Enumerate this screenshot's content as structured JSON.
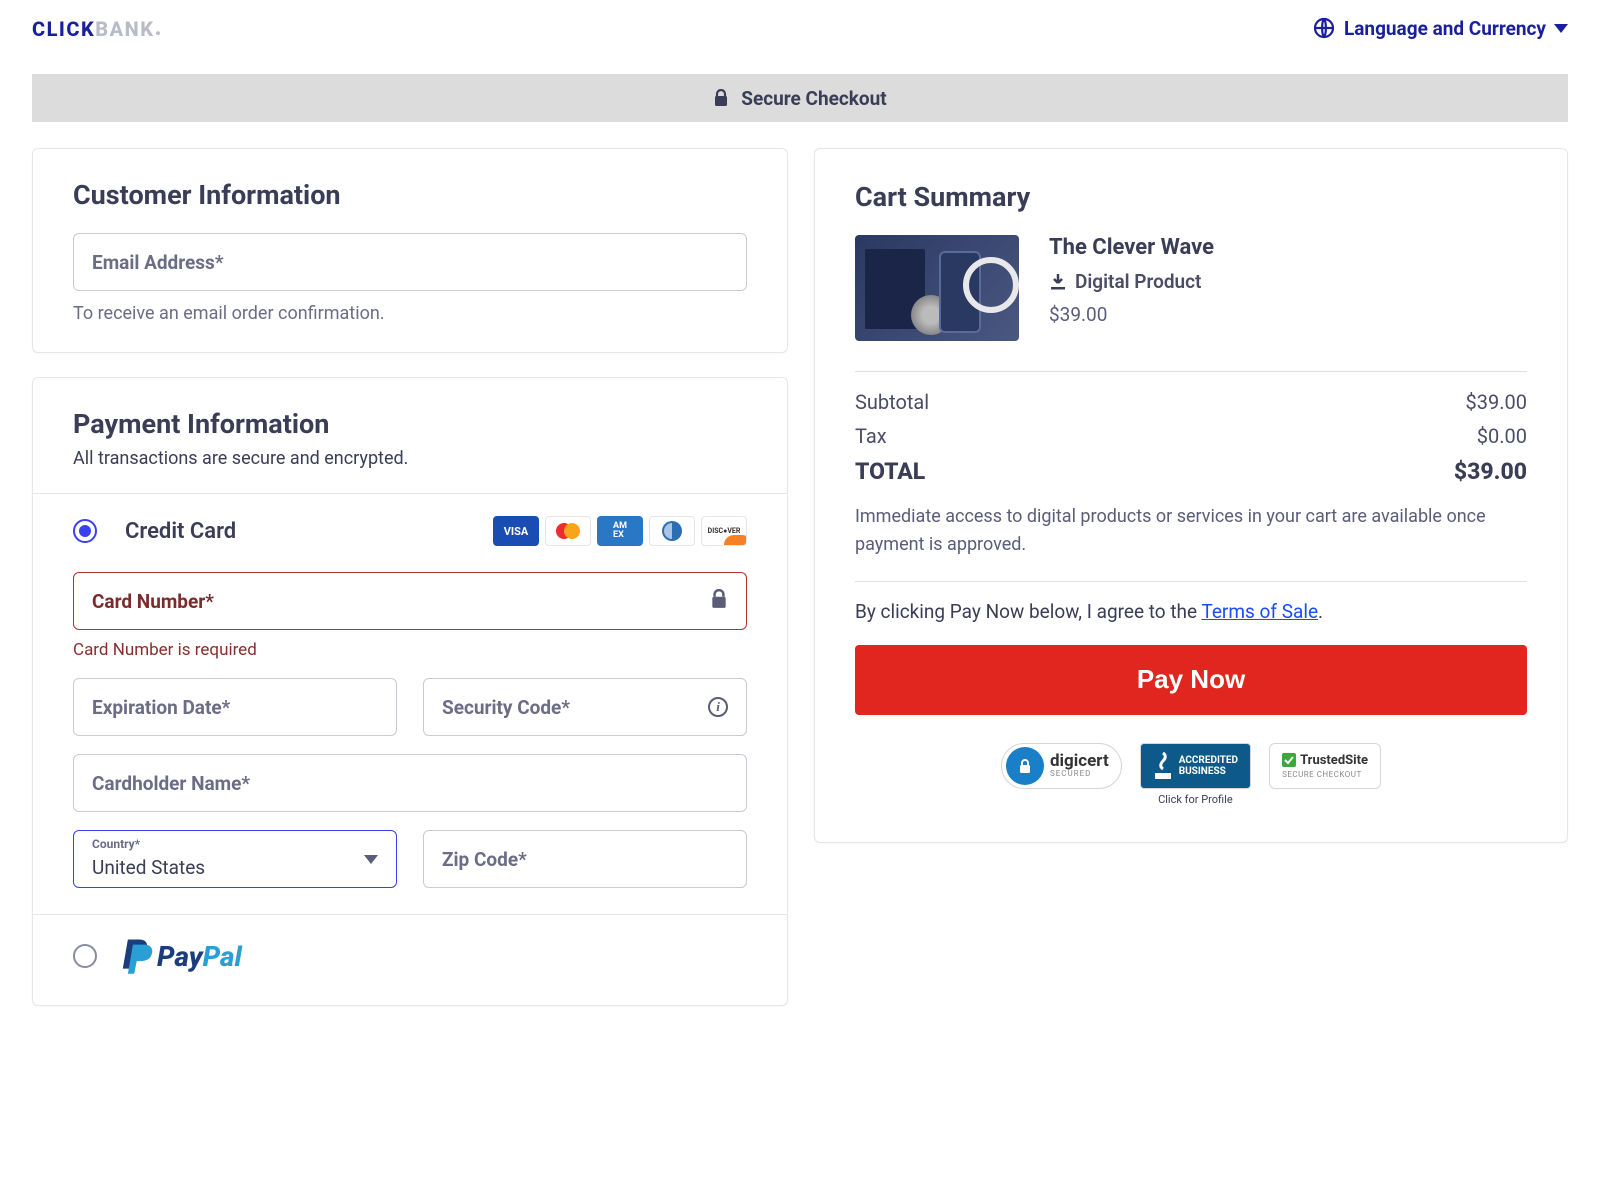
{
  "header": {
    "logo_click": "CLICK",
    "logo_bank": "BANK",
    "lang_label": "Language and Currency"
  },
  "secure_bar": "Secure Checkout",
  "customer": {
    "heading": "Customer Information",
    "email_placeholder": "Email Address*",
    "email_helper": "To receive an email order confirmation."
  },
  "payment": {
    "heading": "Payment Information",
    "subheading": "All transactions are secure and encrypted.",
    "cc_label": "Credit Card",
    "card_number_ph": "Card Number*",
    "card_number_err": "Card Number is required",
    "exp_ph": "Expiration Date*",
    "cvc_ph": "Security Code*",
    "name_ph": "Cardholder Name*",
    "country_label": "Country*",
    "country_value": "United States",
    "zip_ph": "Zip Code*",
    "paypal_pay": "Pay",
    "paypal_pal": "Pal"
  },
  "cart": {
    "heading": "Cart Summary",
    "product_title": "The Clever Wave",
    "product_type": "Digital Product",
    "product_price": "$39.00",
    "subtotal_label": "Subtotal",
    "subtotal_value": "$39.00",
    "tax_label": "Tax",
    "tax_value": "$0.00",
    "total_label": "TOTAL",
    "total_value": "$39.00",
    "note": "Immediate access to digital products or services in your cart are available once payment is approved.",
    "agree_prefix": "By clicking Pay Now below, I agree to the ",
    "agree_link": "Terms of Sale",
    "agree_suffix": ".",
    "pay_btn": "Pay Now",
    "digicert": "digicert",
    "digicert_sub": "SECURED",
    "bbb_top": "ACCREDITED",
    "bbb_bot": "BUSINESS",
    "bbb_caption": "Click for Profile",
    "trusted": "TrustedSite",
    "trusted_sub": "SECURE CHECKOUT"
  }
}
